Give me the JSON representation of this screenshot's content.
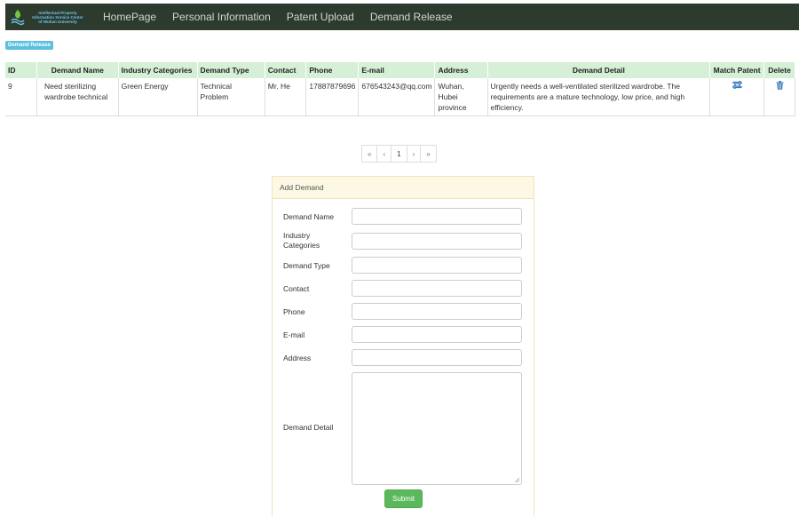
{
  "nav": {
    "logo_lines": [
      "Intellectual Property",
      "Information Service Center",
      "of Wuhan University"
    ],
    "items": [
      "HomePage",
      "Personal Information",
      "Patent Upload",
      "Demand Release"
    ]
  },
  "badge": "Demand Release",
  "table": {
    "headers": {
      "id": "ID",
      "name": "Demand Name",
      "industry": "Industry Categories",
      "type": "Demand Type",
      "contact": "Contact",
      "phone": "Phone",
      "email": "E-mail",
      "address": "Address",
      "detail": "Demand Detail",
      "match": "Match Patent",
      "delete": "Delete"
    },
    "rows": [
      {
        "id": "9",
        "name": "Need sterilizing wardrobe technical",
        "industry": "Green Energy",
        "type": "Technical Problem",
        "contact": "Mr. He",
        "phone": "17887879696",
        "email": "676543243@qq.com",
        "address": "Wuhan, Hubei province",
        "detail": "Urgently needs a well-ventilated sterilized wardrobe. The requirements are a mature technology, low price, and high efficiency.",
        "match_icon": "retweet-icon",
        "delete_icon": "trash-icon"
      }
    ]
  },
  "pagination": {
    "first": "«",
    "prev": "‹",
    "page": "1",
    "next": "›",
    "last": "»"
  },
  "form": {
    "heading": "Add Demand",
    "labels": {
      "name": "Demand Name",
      "industry": "Industry Categories",
      "type": "Demand Type",
      "contact": "Contact",
      "phone": "Phone",
      "email": "E-mail",
      "address": "Address",
      "detail": "Demand Detail"
    },
    "values": {
      "name": "",
      "industry": "",
      "type": "",
      "contact": "",
      "phone": "",
      "email": "",
      "address": "",
      "detail": ""
    },
    "submit": "Submit"
  },
  "colors": {
    "navbar": "#2d3b2e",
    "badge": "#5bc0de",
    "table_header": "#d5f0d6",
    "panel_heading": "#fcf8e3",
    "submit": "#5cb85c",
    "icon": "#3a7ab8"
  }
}
